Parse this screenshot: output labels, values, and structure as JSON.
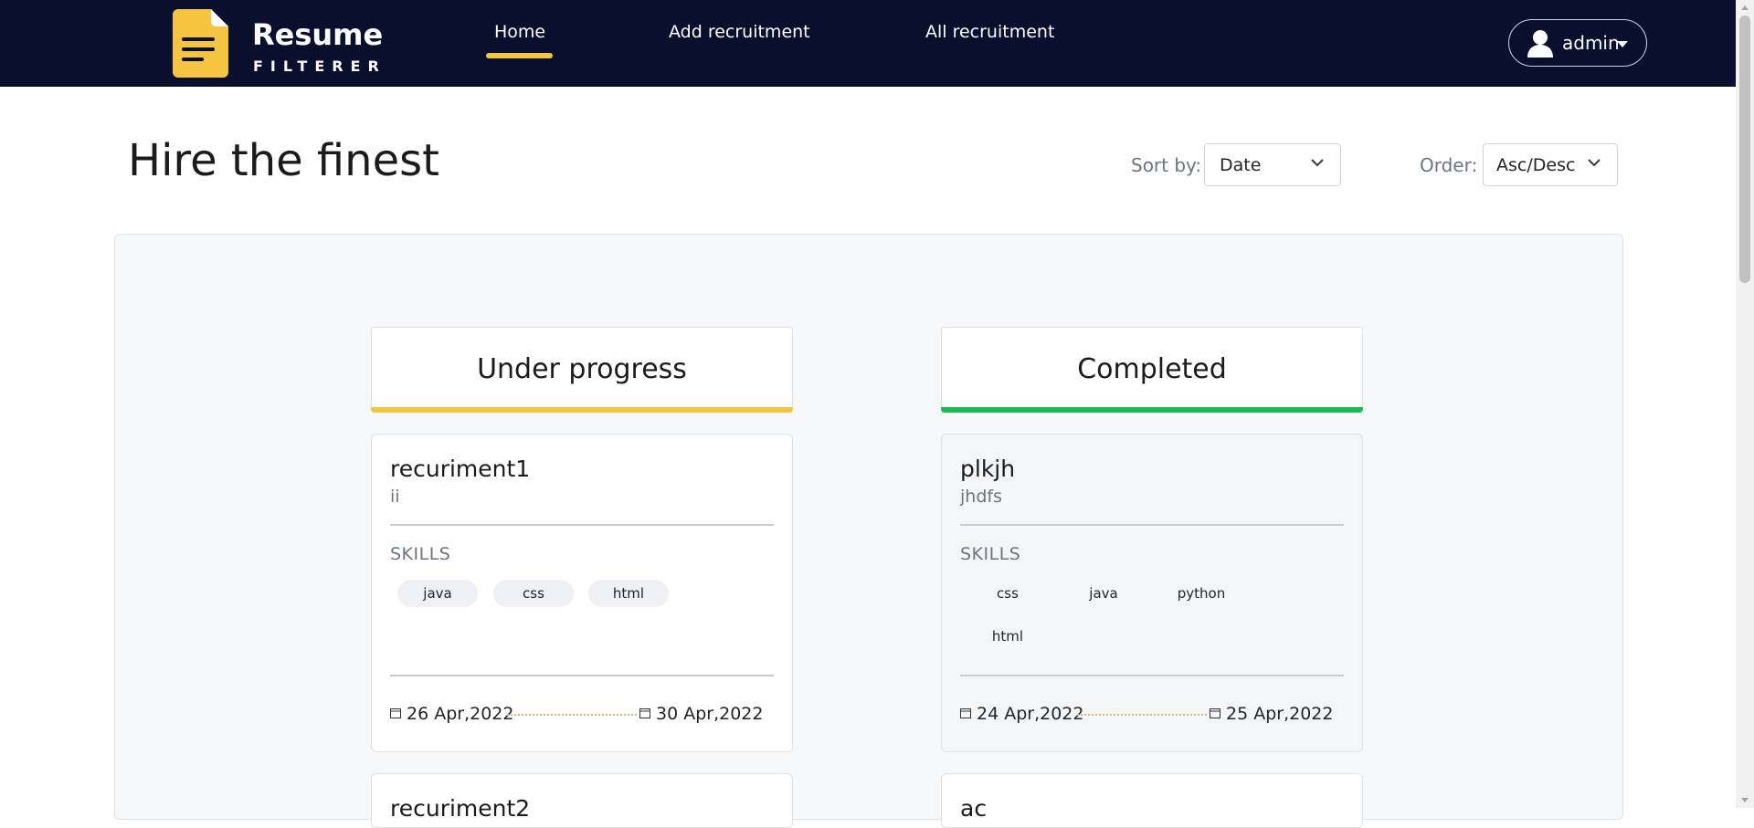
{
  "nav": {
    "brand_title": "Resume",
    "brand_subtitle": "FILTERER",
    "links": [
      "Home",
      "Add recruitment",
      "All recruitment"
    ],
    "active": "Home",
    "user": "admin",
    "logo_icon": "document-icon",
    "user_icon": "user-icon"
  },
  "header": {
    "title": "Hire the finest",
    "sort_label": "Sort by:",
    "sort_value": "Date",
    "order_label": "Order:",
    "order_value": "Asc/Desc"
  },
  "columns": {
    "progress": {
      "title": "Under progress",
      "color": "#f5c542"
    },
    "done": {
      "title": "Completed",
      "color": "#1db954"
    }
  },
  "cards": {
    "a": {
      "title": "recuriment1",
      "subtitle": "ii",
      "skills_label": "SKILLS",
      "skills": [
        "java",
        "css",
        "html"
      ],
      "start_date": "26 Apr,2022",
      "end_date": "30 Apr,2022"
    },
    "b": {
      "title": "plkjh",
      "subtitle": "jhdfs",
      "skills_label": "SKILLS",
      "skills": [
        "css",
        "java",
        "python",
        "html"
      ],
      "start_date": "24 Apr,2022",
      "end_date": "25 Apr,2022"
    },
    "c": {
      "title": "recuriment2"
    },
    "d": {
      "title": "ac"
    }
  },
  "colors": {
    "navbar": "#0b0f2e",
    "accent_yellow": "#f5c542",
    "accent_green": "#1db954"
  }
}
